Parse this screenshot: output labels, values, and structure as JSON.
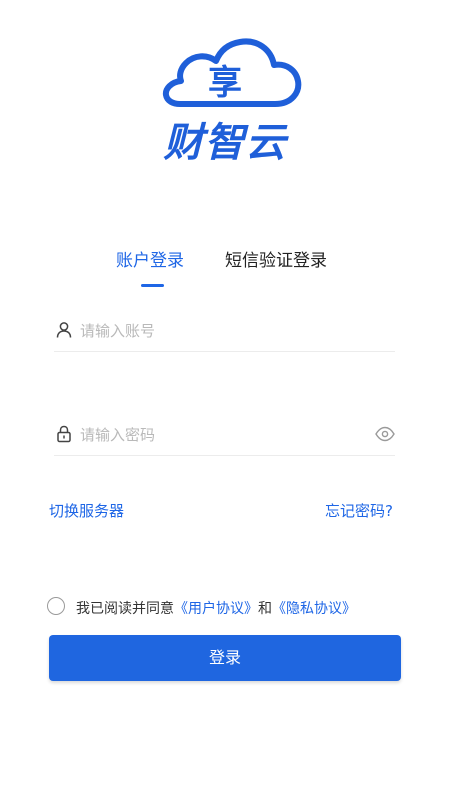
{
  "brand": {
    "name": "财智云",
    "logo_glyph": "享",
    "color": "#1f5fd9"
  },
  "tabs": [
    {
      "label": "账户登录",
      "active": true
    },
    {
      "label": "短信验证登录",
      "active": false
    }
  ],
  "form": {
    "account": {
      "placeholder": "请输入账号",
      "value": "",
      "icon": "user-icon"
    },
    "password": {
      "placeholder": "请输入密码",
      "value": "",
      "icon": "lock-icon",
      "toggle_icon": "eye-icon"
    }
  },
  "links": {
    "switch_server": "切换服务器",
    "forgot_password": "忘记密码?"
  },
  "agreement": {
    "checked": false,
    "prefix": "我已阅读并同意",
    "user_agreement": "《用户协议》",
    "and": "和",
    "privacy_policy": "《隐私协议》"
  },
  "login_button": "登录",
  "colors": {
    "accent": "#1e66e6",
    "button": "#1f66e0"
  }
}
